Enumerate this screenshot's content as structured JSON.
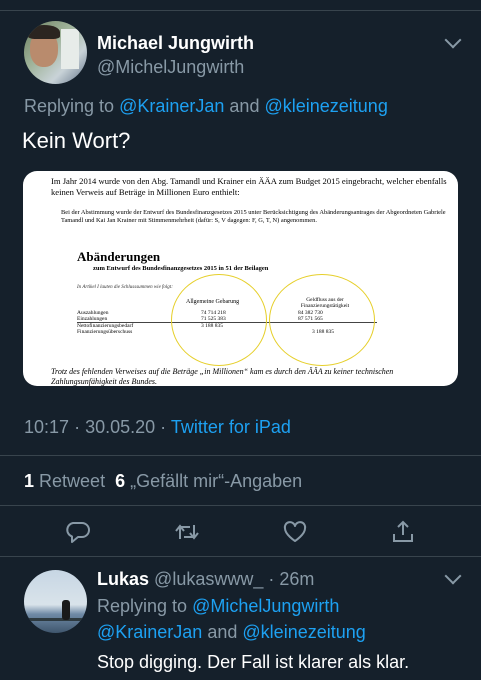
{
  "tweet": {
    "author_name": "Michael Jungwirth",
    "author_handle": "@MichelJungwirth",
    "replying_to_label": "Replying to",
    "mention1": "@KrainerJan",
    "and_label": "and",
    "mention2": "@kleinezeitung",
    "text": "Kein Wort?",
    "time": "10:17",
    "date": "30.05.20",
    "sep": "·",
    "client": "Twitter for iPad",
    "retweets_count": "1",
    "retweets_label": "Retweet",
    "likes_count": "6",
    "likes_label": "„Gefällt mir“-Angaben"
  },
  "image": {
    "para1": "Im Jahr 2014 wurde von den Abg. Tamandl und Krainer ein ÄÄA zum Budget 2015 eingebracht, welcher ebenfalls keinen Verweis auf Beträge in Millionen Euro enthielt:",
    "para2": "Bei der Abstimmung wurde der Entwurf des Bundesfinanzgesetzes 2015 unter Berücksichtigung des Abänderungsantrages der Abgeordneten Gabriele Tamandl und Kai Jan Krainer mit Stimmenmehrheit (dafür: S, V dagegen: F, G, T, N) angenommen.",
    "heading": "Abänderungen",
    "subheading": "zum Entwurf des Bundesfinanzgesetzes 2015 in 51 der Beilagen",
    "note": "In Artikel I lauten die Schlusssummen wie folgt:",
    "col1": "Allgemeine Gebarung",
    "col2": "Geldfluss aus der Finanzierungstätigkeit",
    "rows": [
      {
        "label": "Auszahlungen",
        "v1": "74 714 218",
        "v2": "84 382 730"
      },
      {
        "label": "Einzahlungen",
        "v1": "71 525 383",
        "v2": "87 571 565"
      },
      {
        "label": "Nettofinanzierungsbedarf",
        "v1": "3 188 835",
        "v2": ""
      },
      {
        "label": "Finanzierungsüberschuss",
        "v1": "",
        "v2": "3 188 835"
      }
    ],
    "footer": "Trotz des fehlenden Verweises auf die Beträge „in Millionen“ kam es durch den ÄÄA zu keiner technischen Zahlungsunfähigkeit des Bundes."
  },
  "reply": {
    "author_name": "Lukas",
    "author_handle": "@lukaswww_",
    "sep": "·",
    "age": "26m",
    "replying_to_label": "Replying to",
    "mention1": "@MichelJungwirth",
    "mention2": "@KrainerJan",
    "and_label": "and",
    "mention3": "@kleinezeitung",
    "text": "Stop digging. Der Fall ist klarer als klar."
  },
  "icons": [
    "reply-icon",
    "retweet-icon",
    "like-icon",
    "share-icon",
    "chevron-down-icon"
  ],
  "colors": {
    "background": "#15202b",
    "accent": "#1da1f2",
    "secondary_text": "#8899a6",
    "divider": "#38444d"
  }
}
